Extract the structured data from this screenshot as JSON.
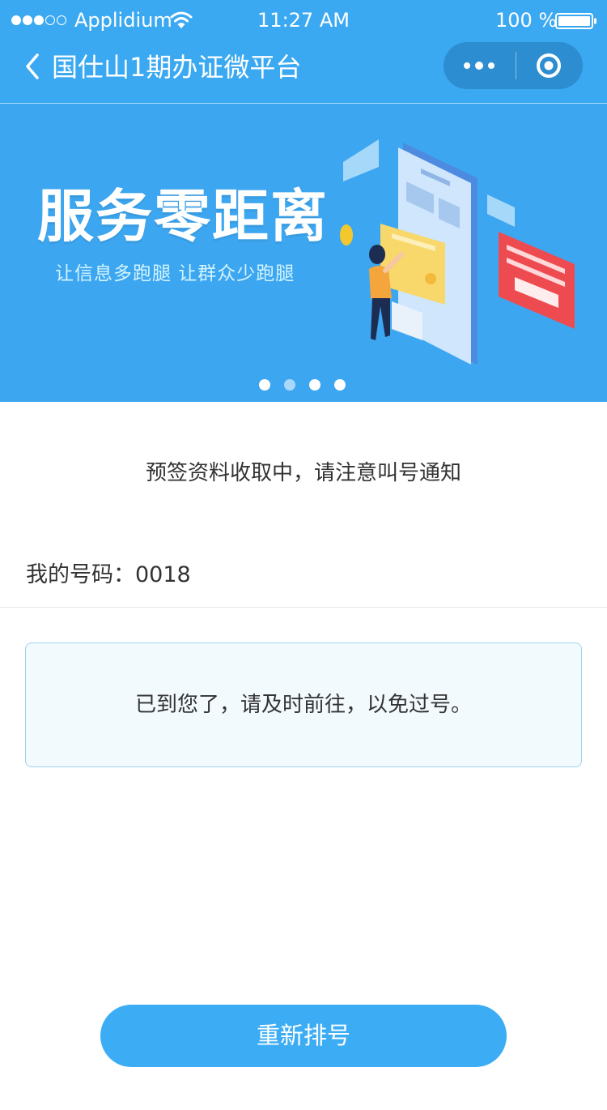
{
  "status_bar": {
    "carrier": "Applidium",
    "time": "11:27 AM",
    "battery": "100 %",
    "signal_strength": 3,
    "signal_total": 5
  },
  "nav": {
    "title": "国仕山1期办证微平台",
    "icons": [
      "chevron-left-icon",
      "more-dots-icon",
      "target-circle-icon"
    ]
  },
  "banner": {
    "title": "服务零距离",
    "subtitle": "让信息多跑腿  让群众少跑腿",
    "pages": 4,
    "active_page": 1
  },
  "main": {
    "notice": "预签资料收取中，请注意叫号通知",
    "my_number": "我的号码：0018",
    "alert": "已到您了，请及时前往，以免过号。",
    "requeue_label": "重新排号"
  },
  "colors": {
    "primary": "#3BA9F1",
    "capsule": "#2C8DD0",
    "button": "#3CADF4",
    "alert_border": "#9FD2EE",
    "alert_bg": "#F3FAFE"
  }
}
